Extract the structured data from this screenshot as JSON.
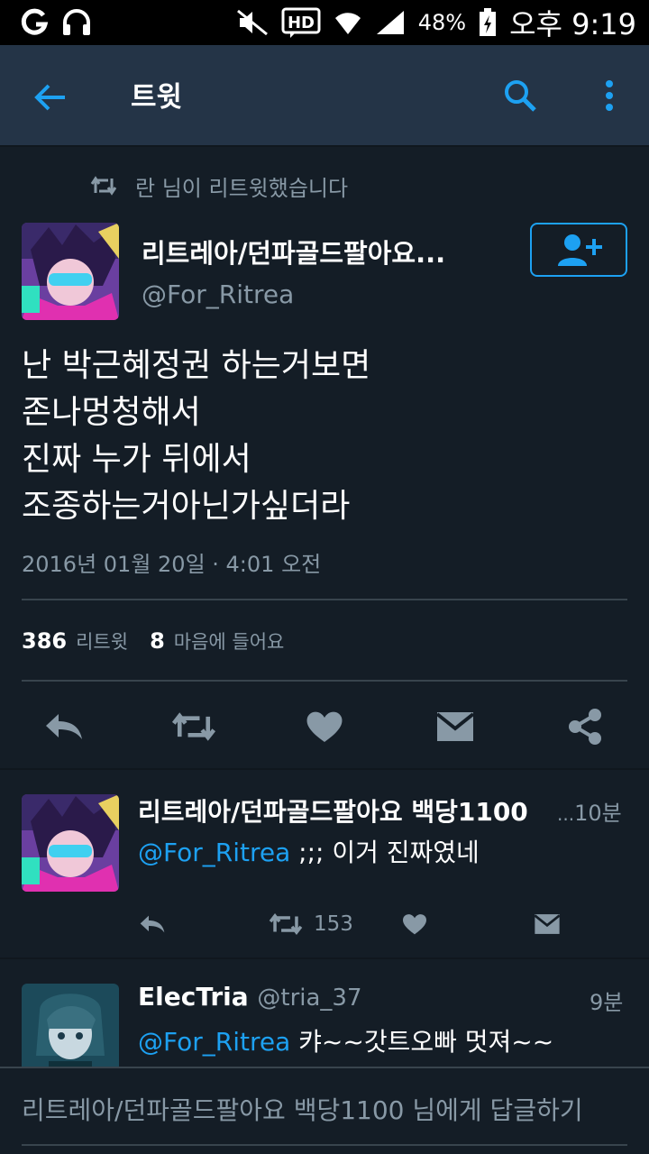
{
  "status_bar": {
    "battery": "48%",
    "time": "오후 9:19"
  },
  "app_bar": {
    "title": "트윗"
  },
  "tweet": {
    "retweet_context": "란 님이 리트윗했습니다",
    "author_name": "리트레아/던파골드팔아요...",
    "author_handle": "@For_Ritrea",
    "text_lines": [
      "난 박근혜정권 하는거보면",
      "존나멍청해서",
      "진짜 누가 뒤에서",
      "조종하는거아닌가싶더라"
    ],
    "date": "2016년 01월 20일 · 4:01 오전",
    "retweet_count": "386",
    "retweet_label": "리트윗",
    "like_count": "8",
    "like_label": "마음에 들어요"
  },
  "replies": [
    {
      "name": "리트레아/던파골드팔아요 백당1100",
      "ellipsis": "...",
      "time": "10분",
      "mention": "@For_Ritrea",
      "text": " ;;; 이거 진짜였네",
      "retweet_count": "153"
    },
    {
      "name": "ElecTria",
      "handle": "@tria_37",
      "time": "9분",
      "mention": "@For_Ritrea",
      "text": " 캬~~갓트오빠 멋져~~"
    }
  ],
  "compose": {
    "placeholder": "리트레아/던파골드팔아요 백당1100 님에게 답글하기"
  },
  "colors": {
    "background": "#141d26",
    "app_bar": "#243447",
    "accent": "#1da1f2",
    "secondary_text": "#8899a6"
  },
  "icons": [
    "back-arrow-icon",
    "search-icon",
    "more-vert-icon",
    "retweet-icon",
    "add-user-icon",
    "reply-icon",
    "heart-icon",
    "message-icon",
    "share-icon"
  ]
}
